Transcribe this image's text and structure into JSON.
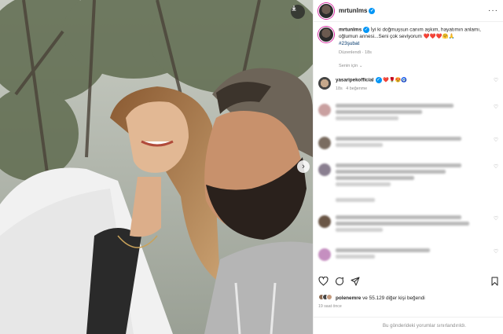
{
  "post": {
    "username": "mrtunlms",
    "caption_user": "mrtunlms",
    "caption_text": "İyi ki doğmuşsun canım aşkım, hayatımın anlamı, oğlumun annesi...Seni çok seviyorum",
    "caption_emojis": "❤️❤️❤️🤗🙏",
    "hashtag": "#23şubat",
    "edited_meta": "Düzenlendi · 18s",
    "translate_label": "Senin için",
    "photo_description_icons": [
      "download-icon",
      "next-arrow-icon"
    ]
  },
  "comments": [
    {
      "username": "yasaripekofficial",
      "text": "❤️🌹😍🧿",
      "meta_time": "18s",
      "meta_likes": "4 beğenme"
    }
  ],
  "actions": {
    "icons": [
      "heart-icon",
      "comment-icon",
      "share-icon",
      "bookmark-icon"
    ]
  },
  "likes": {
    "text_user": "polenemre",
    "text_rest": "ve 55.129 diğer kişi beğendi"
  },
  "time_ago": "19 saat önce",
  "comments_limited": "Bu gönderideki yorumlar sınırlandırıldı.",
  "colors": {
    "accent": "#0095f6",
    "heart_red": "#ed4956",
    "hashtag": "#00376b",
    "muted": "#8e8e8e"
  }
}
